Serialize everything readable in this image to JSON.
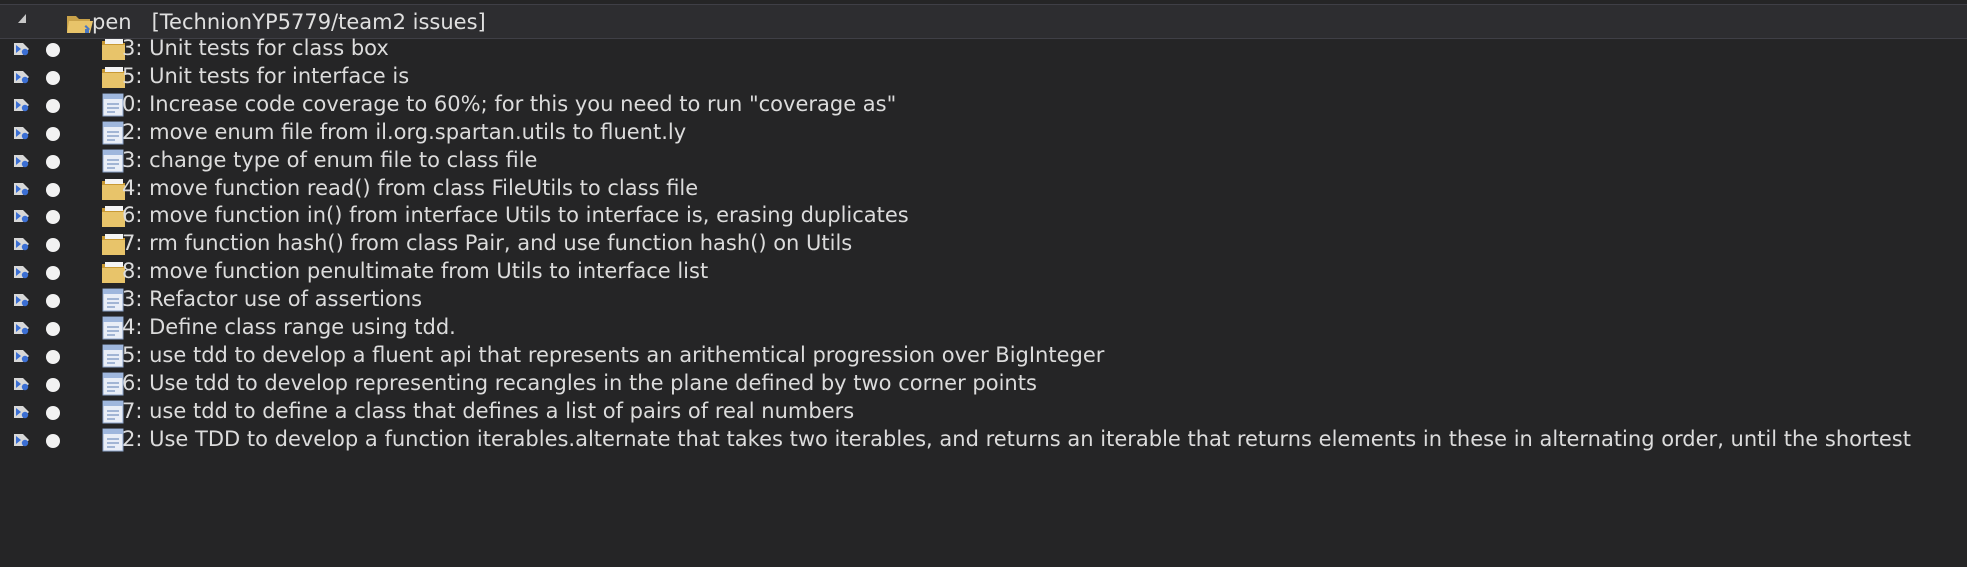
{
  "colors": {
    "background": "#252526",
    "header_background": "#2d2d30",
    "text": "#dcdcdc",
    "folder_yellow": "#e8c46a",
    "doc_blue": "#9fb7dd"
  },
  "header": {
    "expander_icon": "expanded-triangle-icon",
    "folder_icon": "open-folder-icon",
    "label": "pen   [TechnionYP5779/team2 issues]"
  },
  "issues": [
    {
      "label": "3: Unit tests for class box",
      "icon": "folder-item-icon"
    },
    {
      "label": "5: Unit tests for interface is",
      "icon": "folder-item-icon"
    },
    {
      "label": "0: Increase code coverage to 60%; for this you need to run \"coverage as\"",
      "icon": "document-item-icon"
    },
    {
      "label": "2: move enum file from il.org.spartan.utils to fluent.ly",
      "icon": "document-item-icon"
    },
    {
      "label": "3: change type of enum file to class file",
      "icon": "document-item-icon"
    },
    {
      "label": "4: move function read() from class FileUtils to class file",
      "icon": "folder-item-icon"
    },
    {
      "label": "6: move function in() from interface Utils to interface is, erasing duplicates",
      "icon": "folder-item-icon"
    },
    {
      "label": "7: rm function hash() from class Pair, and use function hash() on Utils",
      "icon": "folder-item-icon"
    },
    {
      "label": "8: move function penultimate from Utils to interface list",
      "icon": "folder-item-icon"
    },
    {
      "label": "3: Refactor use of assertions",
      "icon": "document-item-icon"
    },
    {
      "label": "4: Define class range using tdd.",
      "icon": "document-item-icon"
    },
    {
      "label": "5: use tdd to develop a fluent api that represents an arithemtical progression over BigInteger",
      "icon": "document-item-icon"
    },
    {
      "label": "6: Use tdd to develop representing recangles in the plane defined by two corner points",
      "icon": "document-item-icon"
    },
    {
      "label": "7: use tdd to define a class that defines a list of pairs of real numbers",
      "icon": "document-item-icon"
    },
    {
      "label": "2: Use TDD to develop a function iterables.alternate that takes two iterables, and returns an iterable that returns elements in these in alternating order, until the shortest",
      "icon": "document-item-icon"
    }
  ]
}
